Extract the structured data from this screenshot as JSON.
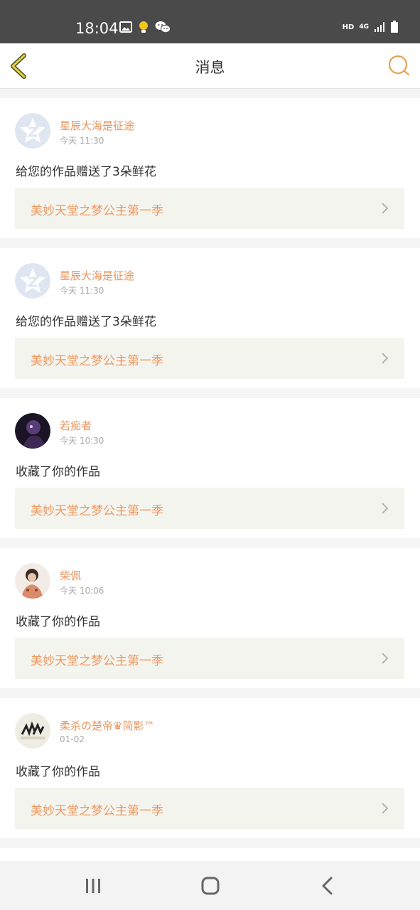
{
  "status_bar": {
    "time": "18:04",
    "left_icons": [
      "gallery-icon",
      "notification-bulb-icon",
      "wechat-icon"
    ],
    "network_hd": "HD",
    "network_type": "4G",
    "right_icons": [
      "signal-icon",
      "battery-icon"
    ]
  },
  "header": {
    "title": "消息",
    "back_icon": "chevron-left-icon",
    "search_icon": "search-icon",
    "accent_color": "#e8a04f"
  },
  "notifications": [
    {
      "user": "星辰大海是征途",
      "time": "今天 11:30",
      "message": "给您的作品赠送了3朵鲜花",
      "work_title": "美妙天堂之梦公主第一季",
      "avatar": "default-avatar-icon"
    },
    {
      "user": "星辰大海是征途",
      "time": "今天 11:30",
      "message": "给您的作品赠送了3朵鲜花",
      "work_title": "美妙天堂之梦公主第一季",
      "avatar": "default-avatar-icon"
    },
    {
      "user": "若痴者",
      "time": "今天 10:30",
      "message": "收藏了你的作品",
      "work_title": "美妙天堂之梦公主第一季",
      "avatar": "user-photo-avatar"
    },
    {
      "user": "柴佩",
      "time": "今天 10:06",
      "message": "收藏了你的作品",
      "work_title": "美妙天堂之梦公主第一季",
      "avatar": "user-photo-avatar"
    },
    {
      "user": "柔杀の楚帝♛简影™",
      "time": "01-02",
      "message": "收藏了你的作品",
      "work_title": "美妙天堂之梦公主第一季",
      "avatar": "user-photo-avatar"
    }
  ],
  "nav_bar": {
    "buttons": [
      "recent-apps-icon",
      "home-icon",
      "back-icon"
    ]
  },
  "colors": {
    "username": "#e8955f",
    "work_title": "#ec9964",
    "work_bg": "#f4f4ee",
    "page_bg": "#f5f5f5"
  }
}
